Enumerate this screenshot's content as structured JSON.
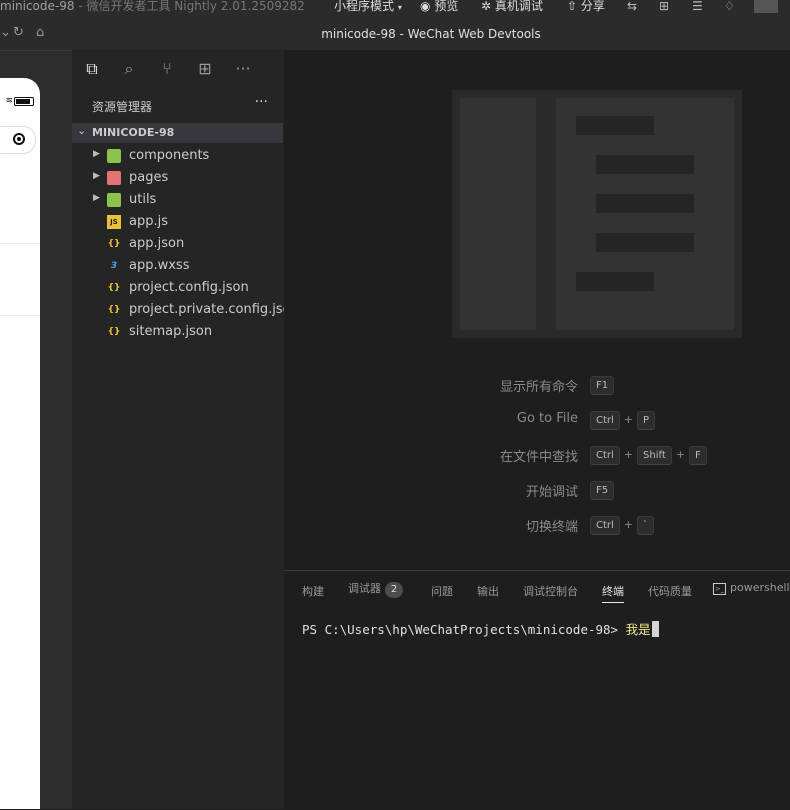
{
  "titlebar": {
    "app_title": "minicode-98",
    "app_subtitle": "- 微信开发者工具 Nightly 2.01.2509282",
    "mode_label": "小程序模式",
    "preview_label": "预览",
    "realdevice_label": "真机调试",
    "share_label": "分享"
  },
  "window": {
    "title": "minicode-98 - WeChat Web Devtools"
  },
  "explorer": {
    "header": "资源管理器",
    "more": "···",
    "project": "MINICODE-98",
    "items": [
      {
        "label": "components",
        "type": "folder",
        "icon": "folder-components-icon"
      },
      {
        "label": "pages",
        "type": "folder",
        "icon": "folder-pages-icon"
      },
      {
        "label": "utils",
        "type": "folder",
        "icon": "folder-utils-icon"
      },
      {
        "label": "app.js",
        "type": "file",
        "icon": "js-file-icon"
      },
      {
        "label": "app.json",
        "type": "file",
        "icon": "json-file-icon"
      },
      {
        "label": "app.wxss",
        "type": "file",
        "icon": "css-file-icon"
      },
      {
        "label": "project.config.json",
        "type": "file",
        "icon": "json-file-icon"
      },
      {
        "label": "project.private.config.json",
        "type": "file",
        "icon": "json-file-icon"
      },
      {
        "label": "sitemap.json",
        "type": "file",
        "icon": "json-file-icon"
      }
    ]
  },
  "welcome": {
    "shortcuts": [
      {
        "label": "显示所有命令",
        "keys": [
          "F1"
        ]
      },
      {
        "label": "Go to File",
        "keys": [
          "Ctrl",
          "P"
        ]
      },
      {
        "label": "在文件中查找",
        "keys": [
          "Ctrl",
          "Shift",
          "F"
        ]
      },
      {
        "label": "开始调试",
        "keys": [
          "F5"
        ]
      },
      {
        "label": "切换终端",
        "keys": [
          "Ctrl",
          "`"
        ]
      }
    ],
    "plus": "+"
  },
  "panel": {
    "tabs": {
      "build": "构建",
      "debugger": "调试器",
      "debugger_badge": "2",
      "problems": "问题",
      "output": "输出",
      "console": "调试控制台",
      "terminal": "终端",
      "quality": "代码质量",
      "shell": "powershell"
    },
    "terminal": {
      "prompt": "PS C:\\Users\\hp\\WeChatProjects\\minicode-98>",
      "typed": "我是"
    }
  },
  "colors": {
    "background": "#1e1e1e",
    "sidebar": "#252526",
    "selected_row": "#37373d",
    "typed_text": "#f0e68c"
  }
}
